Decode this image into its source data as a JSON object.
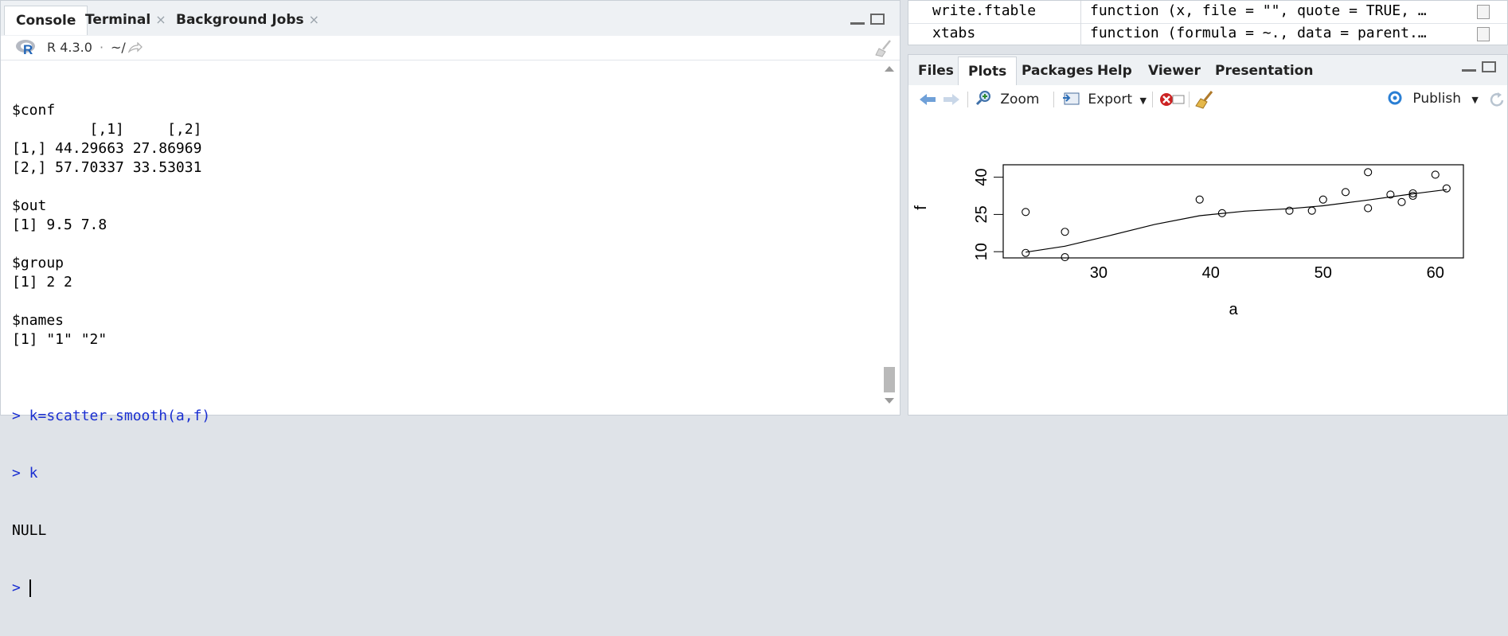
{
  "console": {
    "tabs": [
      {
        "label": "Console"
      },
      {
        "label": "Terminal",
        "close": "×"
      },
      {
        "label": "Background Jobs",
        "close": "×"
      }
    ],
    "r_version": "R 4.3.0",
    "dot": "·",
    "path": "~/",
    "lines": [
      "$conf",
      "         [,1]     [,2]",
      "[1,] 44.29663 27.86969",
      "[2,] 57.70337 33.53031",
      "",
      "$out",
      "[1] 9.5 7.8",
      "",
      "$group",
      "[1] 2 2",
      "",
      "$names",
      "[1] \"1\" \"2\"",
      ""
    ],
    "commands": [
      "> k=scatter.smooth(a,f)",
      "> k"
    ],
    "output_null": "NULL",
    "prompt": "> "
  },
  "help_table": [
    {
      "name": "write.ftable",
      "signature": "function (x, file = \"\", quote = TRUE, …"
    },
    {
      "name": "xtabs",
      "signature": "function (formula = ~., data = parent.…"
    }
  ],
  "plots": {
    "tabs": [
      "Files",
      "Plots",
      "Packages",
      "Help",
      "Viewer",
      "Presentation"
    ],
    "active_tab": "Plots",
    "toolbar": {
      "zoom": "Zoom",
      "export": "Export",
      "publish": "Publish"
    },
    "colors": {
      "publish_icon": "#2a7fd4",
      "remove_icon": "#cc2222",
      "back_arrow": "#6fa0d8"
    }
  },
  "chart_data": {
    "type": "scatter",
    "xlabel": "a",
    "ylabel": "f",
    "x_ticks": [
      30,
      40,
      50,
      60
    ],
    "y_ticks": [
      10,
      25,
      40
    ],
    "xlim": [
      21.5,
      62.5
    ],
    "ylim": [
      7.5,
      45
    ],
    "points": [
      {
        "x": 23.5,
        "y": 9.5
      },
      {
        "x": 23.5,
        "y": 26
      },
      {
        "x": 27,
        "y": 7.8
      },
      {
        "x": 27,
        "y": 18
      },
      {
        "x": 39,
        "y": 31
      },
      {
        "x": 41,
        "y": 25.5
      },
      {
        "x": 47,
        "y": 26.5
      },
      {
        "x": 49,
        "y": 26.5
      },
      {
        "x": 50,
        "y": 31
      },
      {
        "x": 52,
        "y": 34
      },
      {
        "x": 54,
        "y": 27.5
      },
      {
        "x": 54,
        "y": 42
      },
      {
        "x": 56,
        "y": 33
      },
      {
        "x": 57,
        "y": 30
      },
      {
        "x": 58,
        "y": 32.5
      },
      {
        "x": 58,
        "y": 33.5
      },
      {
        "x": 60,
        "y": 41
      },
      {
        "x": 61,
        "y": 35.5
      }
    ],
    "smooth": [
      {
        "x": 23.5,
        "y": 9.8
      },
      {
        "x": 27,
        "y": 12.2
      },
      {
        "x": 31,
        "y": 16.5
      },
      {
        "x": 35,
        "y": 21
      },
      {
        "x": 39,
        "y": 24.5
      },
      {
        "x": 43,
        "y": 26.3
      },
      {
        "x": 47,
        "y": 27.3
      },
      {
        "x": 50,
        "y": 28.5
      },
      {
        "x": 54,
        "y": 30.8
      },
      {
        "x": 58,
        "y": 33.3
      },
      {
        "x": 61,
        "y": 35
      }
    ]
  }
}
